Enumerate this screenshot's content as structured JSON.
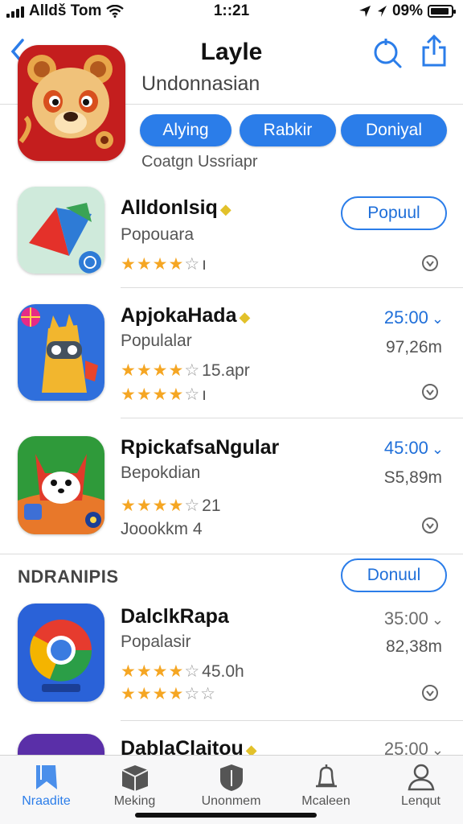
{
  "status_bar": {
    "carrier": "Alldš Tom",
    "time": "1::21",
    "battery": "09%",
    "battery_level": 0.9
  },
  "header": {
    "title": "Layle",
    "subtitle": "Undonnasian",
    "caption": "Coatgn Ussriapr"
  },
  "pills": [
    "Alying",
    "Rabkir",
    "Doniyal"
  ],
  "apps": [
    {
      "name": "Alldonlsiq",
      "subtitle": "Popouara",
      "rating": 4,
      "rating_text": "",
      "extra": "",
      "action": "Popuul",
      "price": "",
      "size": ""
    },
    {
      "name": "ApjokaHada",
      "subtitle": "Populalar",
      "rating": 4,
      "rating_text": "15.apr",
      "rating2": 4,
      "extra": "",
      "action": "",
      "price": "25:00",
      "size": "97,26m"
    },
    {
      "name": "RpickafsaNgular",
      "subtitle": "Bepokdian",
      "rating": 4,
      "rating_text": "21",
      "extra": "Joookkm 4",
      "action": "",
      "price": "45:00",
      "size": "S5,89m"
    },
    {
      "name": "DalclkRapa",
      "subtitle": "Popalasir",
      "rating": 4,
      "rating_text": "45.0h",
      "rating2": 4,
      "extra": "",
      "action": "",
      "price": "35:00",
      "size": "82,38m"
    },
    {
      "name": "DablaClaitou",
      "price": "25:00"
    }
  ],
  "section": {
    "label": "NDRANIPIS",
    "button": "Donuul"
  },
  "tabs": [
    {
      "label": "Nraadite",
      "icon": "bookmark-icon",
      "active": true
    },
    {
      "label": "Meking",
      "icon": "box-icon",
      "active": false
    },
    {
      "label": "Unonmem",
      "icon": "shield-icon",
      "active": false
    },
    {
      "label": "Mcaleen",
      "icon": "bell-icon",
      "active": false
    },
    {
      "label": "Lenqut",
      "icon": "person-icon",
      "active": false
    }
  ],
  "colors": {
    "accent": "#2b7de9",
    "star": "#f5a623"
  }
}
